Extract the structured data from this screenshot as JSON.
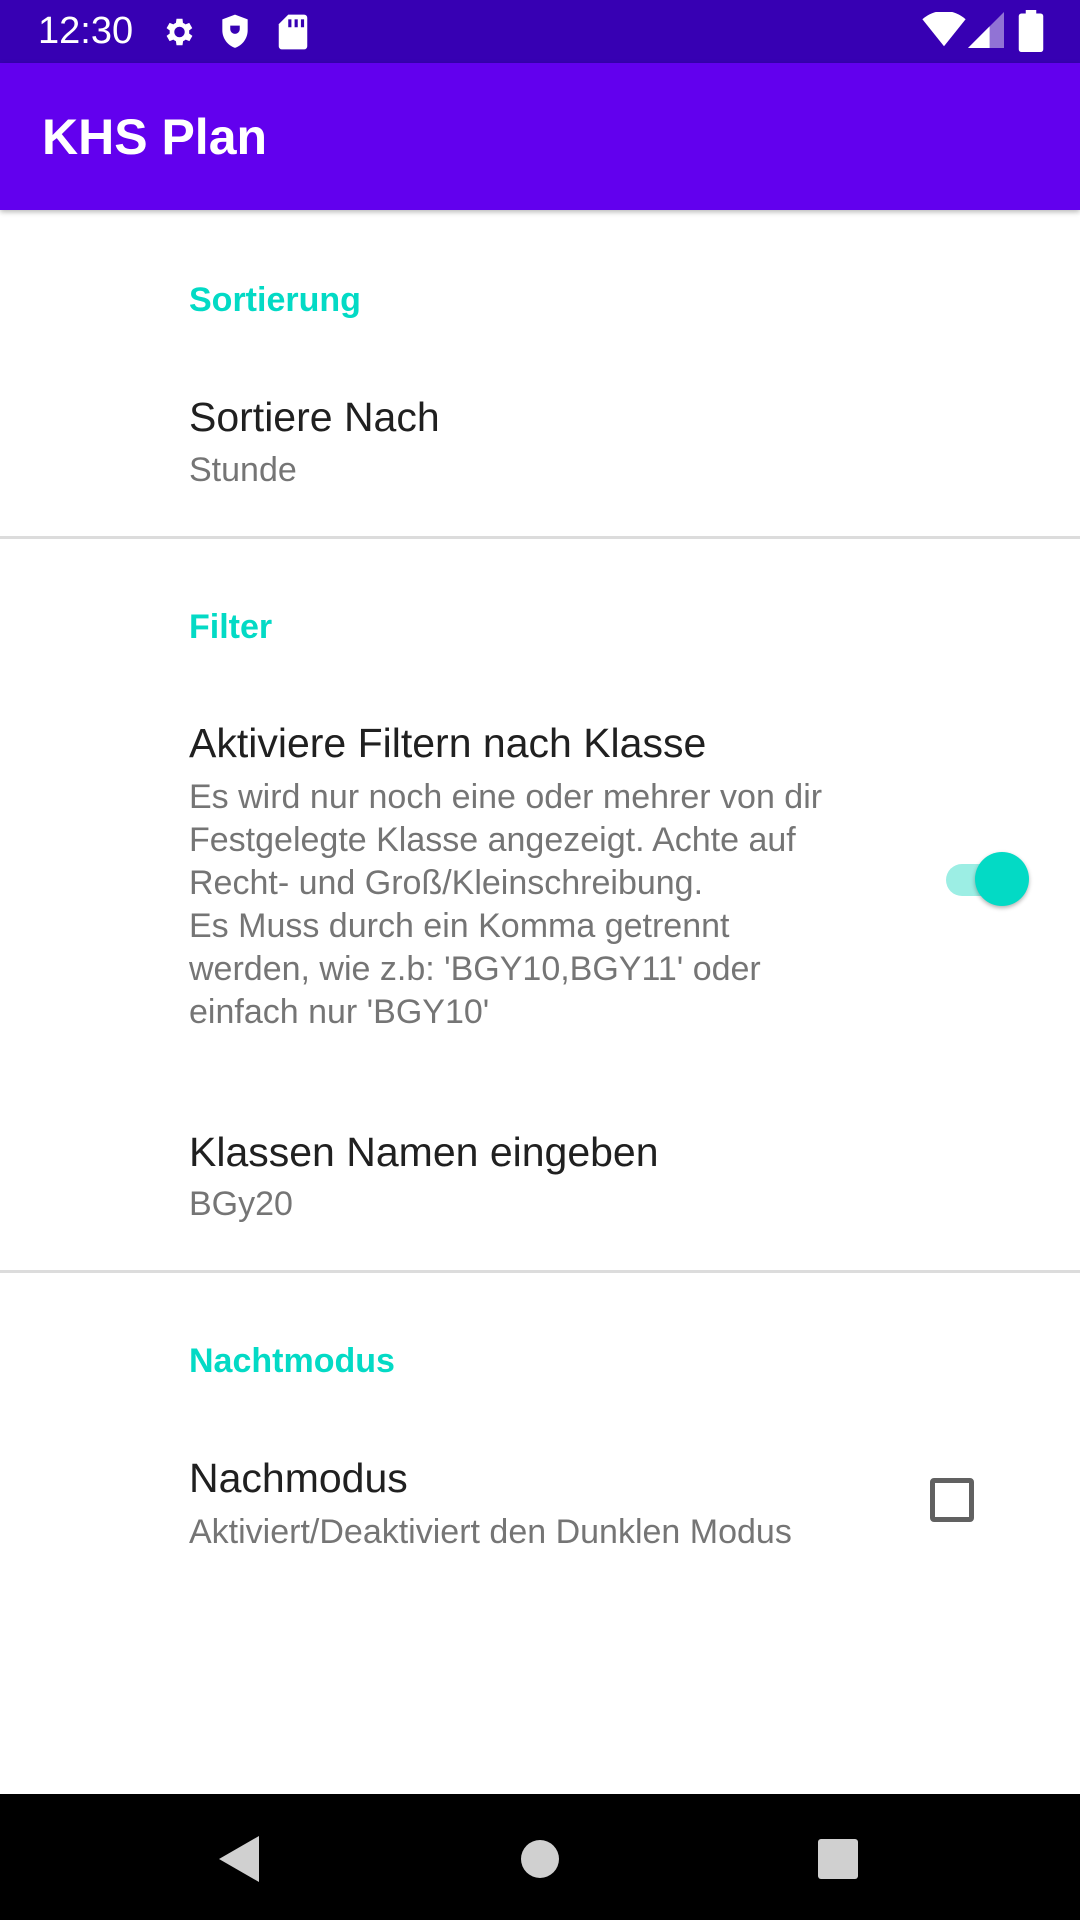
{
  "status_bar": {
    "time": "12:30",
    "icons_left": [
      "gear-icon",
      "shield-icon",
      "sd-card-icon"
    ],
    "icons_right": [
      "wifi-icon",
      "cell-signal-icon",
      "battery-icon"
    ],
    "background": "#3700b3"
  },
  "app_bar": {
    "title": "KHS Plan",
    "background": "#6200ee"
  },
  "sections": {
    "sortierung": {
      "header": "Sortierung",
      "sort_pref": {
        "title": "Sortiere Nach",
        "summary": "Stunde"
      }
    },
    "filter": {
      "header": "Filter",
      "filter_pref": {
        "title": "Aktiviere Filtern nach Klasse",
        "summary": "Es wird nur noch eine oder mehrer von dir\nFestgelegte Klasse angezeigt. Achte auf\nRecht- und Groß/Kleinschreibung.\nEs Muss durch ein Komma getrennt\nwerden, wie z.b: 'BGY10,BGY11' oder\neinfach nur 'BGY10'",
        "switch_on": true
      },
      "class_pref": {
        "title": "Klassen Namen eingeben",
        "summary": "BGy20"
      }
    },
    "nachtmodus": {
      "header": "Nachtmodus",
      "night_pref": {
        "title": "Nachmodus",
        "summary": "Aktiviert/Deaktiviert den Dunklen Modus",
        "checked": false
      }
    }
  },
  "nav_bar": {
    "buttons": [
      "back-icon",
      "home-icon",
      "recents-icon"
    ]
  },
  "colors": {
    "accent": "#03dac5",
    "primary": "#6200ee",
    "primary_dark": "#3700b3"
  }
}
